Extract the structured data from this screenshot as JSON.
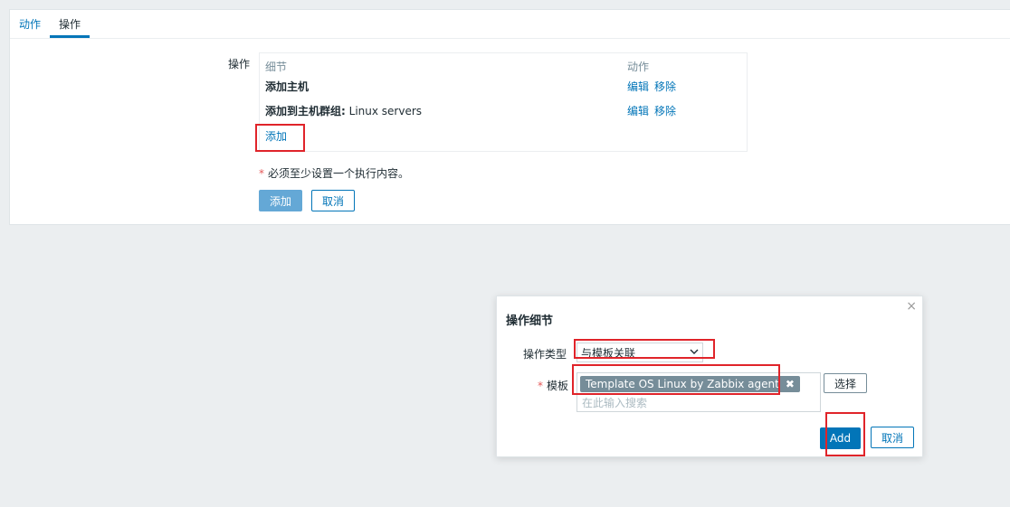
{
  "tabs": [
    {
      "label": "动作"
    },
    {
      "label": "操作"
    }
  ],
  "operations": {
    "label": "操作",
    "columns": {
      "details": "细节",
      "action": "动作"
    },
    "rows": [
      {
        "name": "添加主机",
        "value": "",
        "edit": "编辑",
        "remove": "移除"
      },
      {
        "name": "添加到主机群组:",
        "value": "Linux servers",
        "edit": "编辑",
        "remove": "移除"
      }
    ],
    "add_link": "添加",
    "required_note": "必须至少设置一个执行内容。",
    "add_button": "添加",
    "cancel_button": "取消"
  },
  "dialog": {
    "title": "操作细节",
    "close": "×",
    "type_label": "操作类型",
    "type_value": "与模板关联",
    "template_label": "模板",
    "template_tag": "Template OS Linux by Zabbix agent",
    "search_placeholder": "在此输入搜索",
    "select_button": "选择",
    "add_button": "Add",
    "cancel_button": "取消"
  },
  "colors": {
    "accent": "#0275b8",
    "highlight": "#e0242a",
    "tag_bg": "#768d99"
  }
}
